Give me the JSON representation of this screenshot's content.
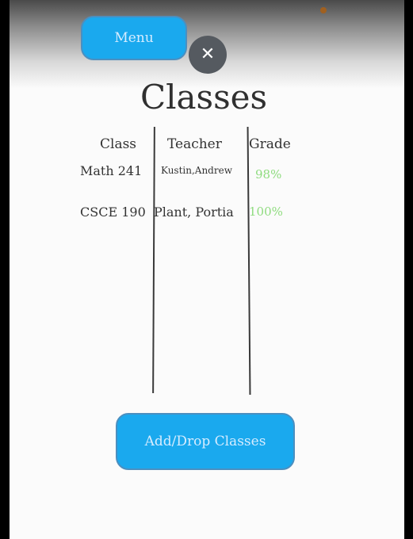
{
  "header": {
    "menu_label": "Menu",
    "close_icon": "close-icon"
  },
  "page": {
    "title": "Classes"
  },
  "table": {
    "columns": [
      "Class",
      "Teacher",
      "Grade"
    ],
    "rows": [
      {
        "class": "Math 241",
        "teacher": "Kustin,Andrew",
        "grade": "98%"
      },
      {
        "class": "CSCE 190",
        "teacher": "Plant, Portia",
        "grade": "100%"
      }
    ]
  },
  "footer": {
    "add_drop_label": "Add/Drop Classes"
  },
  "colors": {
    "button_bg": "#1aa9ee",
    "grade_text": "#8fdc7f",
    "close_bg": "#555a60"
  }
}
